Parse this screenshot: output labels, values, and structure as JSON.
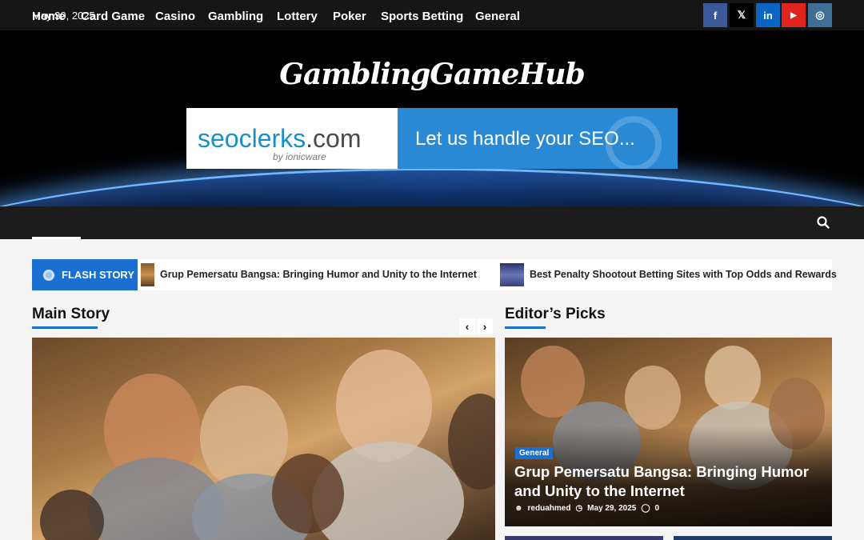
{
  "topbar": {
    "date": "May 30, 2025"
  },
  "social": [
    {
      "icon": "facebook-icon",
      "glyph": "f",
      "color": "#3b5998"
    },
    {
      "icon": "x-icon",
      "glyph": "𝕏",
      "color": "#000000"
    },
    {
      "icon": "linkedin-icon",
      "glyph": "in",
      "color": "#0a66c2"
    },
    {
      "icon": "youtube-icon",
      "glyph": "▶",
      "color": "#e0241d"
    },
    {
      "icon": "instagram-icon",
      "glyph": "◎",
      "color": "#3f6e96"
    }
  ],
  "header": {
    "logo": "GamblingGameHub",
    "banner": {
      "brand": "seoclerks",
      "brand_suffix": ".com",
      "byline": "by ionicware",
      "tagline": "Let us handle your SEO..."
    }
  },
  "nav": {
    "items": [
      "Home",
      "Card Game",
      "Casino",
      "Gambling",
      "Lottery",
      "Poker",
      "Sports Betting",
      "General"
    ],
    "active": "Home"
  },
  "flash": {
    "label": "FLASH STORY",
    "items": [
      "Grup Pemersatu Bangsa: Bringing Humor and Unity to the Internet",
      "Best Penalty Shootout Betting Sites with Top Odds and Rewards"
    ]
  },
  "main_story": {
    "title": "Main Story"
  },
  "editors_picks": {
    "title": "Editor’s Picks",
    "featured": {
      "category": "General",
      "headline": "Grup Pemersatu Bangsa: Bringing Humor and Unity to the Internet",
      "author": "reduahmed",
      "date": "May 29, 2025",
      "comments": "0"
    }
  },
  "colors": {
    "accent": "#1a6fd1",
    "topbar": "#161616",
    "nav": "#1c1c1c"
  }
}
